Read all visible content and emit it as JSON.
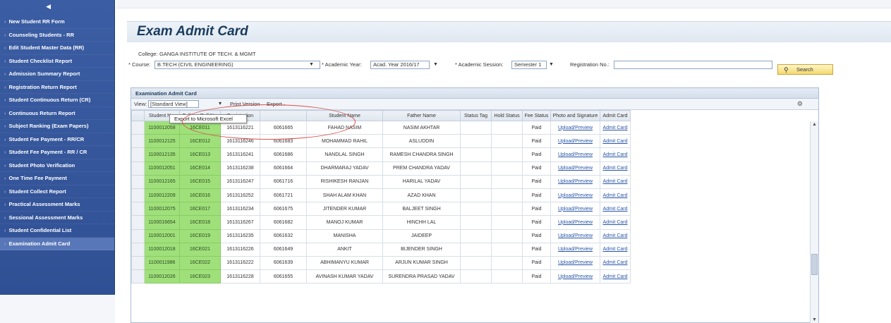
{
  "sidebar": {
    "collapse_icon": "◀",
    "items": [
      "New Student RR Form",
      "Counseling Students - RR",
      "Edit Student Master Data (RR)",
      "Student Checklist Report",
      "Admission Summary Report",
      "Registration Return Report",
      "Student Continuous Return (CR)",
      "Continuous Return Report",
      "Subject Ranking (Exam Papers)",
      "Student Fee Payment - RR/CR",
      "Student Fee Payment - RR / CR",
      "Student Photo Verification",
      "One Time Fee Payment",
      "Student Collect Report",
      "Practical Assessment Marks",
      "Sessional Assessment Marks",
      "Student Confidential List",
      "Examination Admit Card"
    ],
    "active_index": 17
  },
  "page": {
    "title": "Exam Admit Card"
  },
  "filters": {
    "college_label": "College:",
    "college_value": "GANGA INSTITUTE OF TECH. & MGMT",
    "course_label": "* Course:",
    "course_value": "B.TECH (CIVIL ENGINEERING)",
    "academic_year_label": "* Academic Year:",
    "academic_year_value": "Acad. Year 2016/17",
    "academic_session_label": "* Academic Session:",
    "academic_session_value": "Semester 1",
    "registration_label": "Registration No.:",
    "registration_value": "",
    "search_label": "Search"
  },
  "grid": {
    "title": "Examination Admit Card",
    "view_label": "View:",
    "view_value": "[Standard View]",
    "print_label": "Print Version",
    "export_label": "Export",
    "export_menu_item": "Export to Microsoft Excel",
    "columns": [
      "Student No.",
      "College Roll No.",
      "Registration",
      "",
      "Student Name",
      "Father Name",
      "Status Tag",
      "Hold Status",
      "Fee Status",
      "Photo and Signature",
      "Admit Card"
    ],
    "rows": [
      [
        "1100012058",
        "16CE011",
        "1613116221",
        "6061665",
        "FAHAD NASIM",
        "NASIM AKHTAR",
        "",
        "",
        "Paid",
        "Upload/Preview",
        "Admit Card"
      ],
      [
        "1100012125",
        "16CE012",
        "1613116246",
        "6061683",
        "MOHAMMAD RAHIL",
        "ASLUDDIN",
        "",
        "",
        "Paid",
        "Upload/Preview",
        "Admit Card"
      ],
      [
        "1100012135",
        "16CE013",
        "1613116241",
        "6061686",
        "NANDLAL SINGH",
        "RAMESH CHANDRA SINGH",
        "",
        "",
        "Paid",
        "Upload/Preview",
        "Admit Card"
      ],
      [
        "1100012051",
        "16CE014",
        "1613116238",
        "6061664",
        "DHARMARAJ YADAV",
        "PREM CHANDRA YADAV",
        "",
        "",
        "Paid",
        "Upload/Preview",
        "Admit Card"
      ],
      [
        "1100012165",
        "16CE015",
        "1613116247",
        "6061716",
        "RISHIKESH RANJAN",
        "HARILAL YADAV",
        "",
        "",
        "Paid",
        "Upload/Preview",
        "Admit Card"
      ],
      [
        "1100012209",
        "16CE016",
        "1613116252",
        "6061721",
        "SHAH ALAM KHAN",
        "AZAD KHAN",
        "",
        "",
        "Paid",
        "Upload/Preview",
        "Admit Card"
      ],
      [
        "1100012075",
        "16CE017",
        "1613116234",
        "6061675",
        "JITENDER KUMAR",
        "BALJEET SINGH",
        "",
        "",
        "Paid",
        "Upload/Preview",
        "Admit Card"
      ],
      [
        "1100016654",
        "16CE018",
        "1613116267",
        "6061682",
        "MANOJ KUMAR",
        "HINCHH LAL",
        "",
        "",
        "Paid",
        "Upload/Preview",
        "Admit Card"
      ],
      [
        "1100012001",
        "16CE019",
        "1613116235",
        "6061632",
        "MANISHA",
        "JAIDEEP",
        "",
        "",
        "Paid",
        "Upload/Preview",
        "Admit Card"
      ],
      [
        "1100012018",
        "16CE021",
        "1613116226",
        "6061649",
        "ANKIT",
        "BIJENDER SINGH",
        "",
        "",
        "Paid",
        "Upload/Preview",
        "Admit Card"
      ],
      [
        "1100011986",
        "16CE022",
        "1613116222",
        "6061639",
        "ABHIMANYU KUMAR",
        "ARJUN KUMAR SINGH",
        "",
        "",
        "Paid",
        "Upload/Preview",
        "Admit Card"
      ],
      [
        "1100012026",
        "16CE023",
        "1613116228",
        "6061655",
        "AVINASH KUMAR YADAV",
        "SURENDRA PRASAD YADAV",
        "",
        "",
        "Paid",
        "Upload/Preview",
        "Admit Card"
      ]
    ]
  },
  "colors": {
    "sidebar_bg": "#3b5da3",
    "roll_no_highlight": "#9fe07a",
    "annotation": "#d9534f",
    "link": "#2855a8"
  },
  "icons": {
    "search": "search-icon",
    "settings": "settings-icon",
    "dropdown": "chevron-down-icon"
  }
}
